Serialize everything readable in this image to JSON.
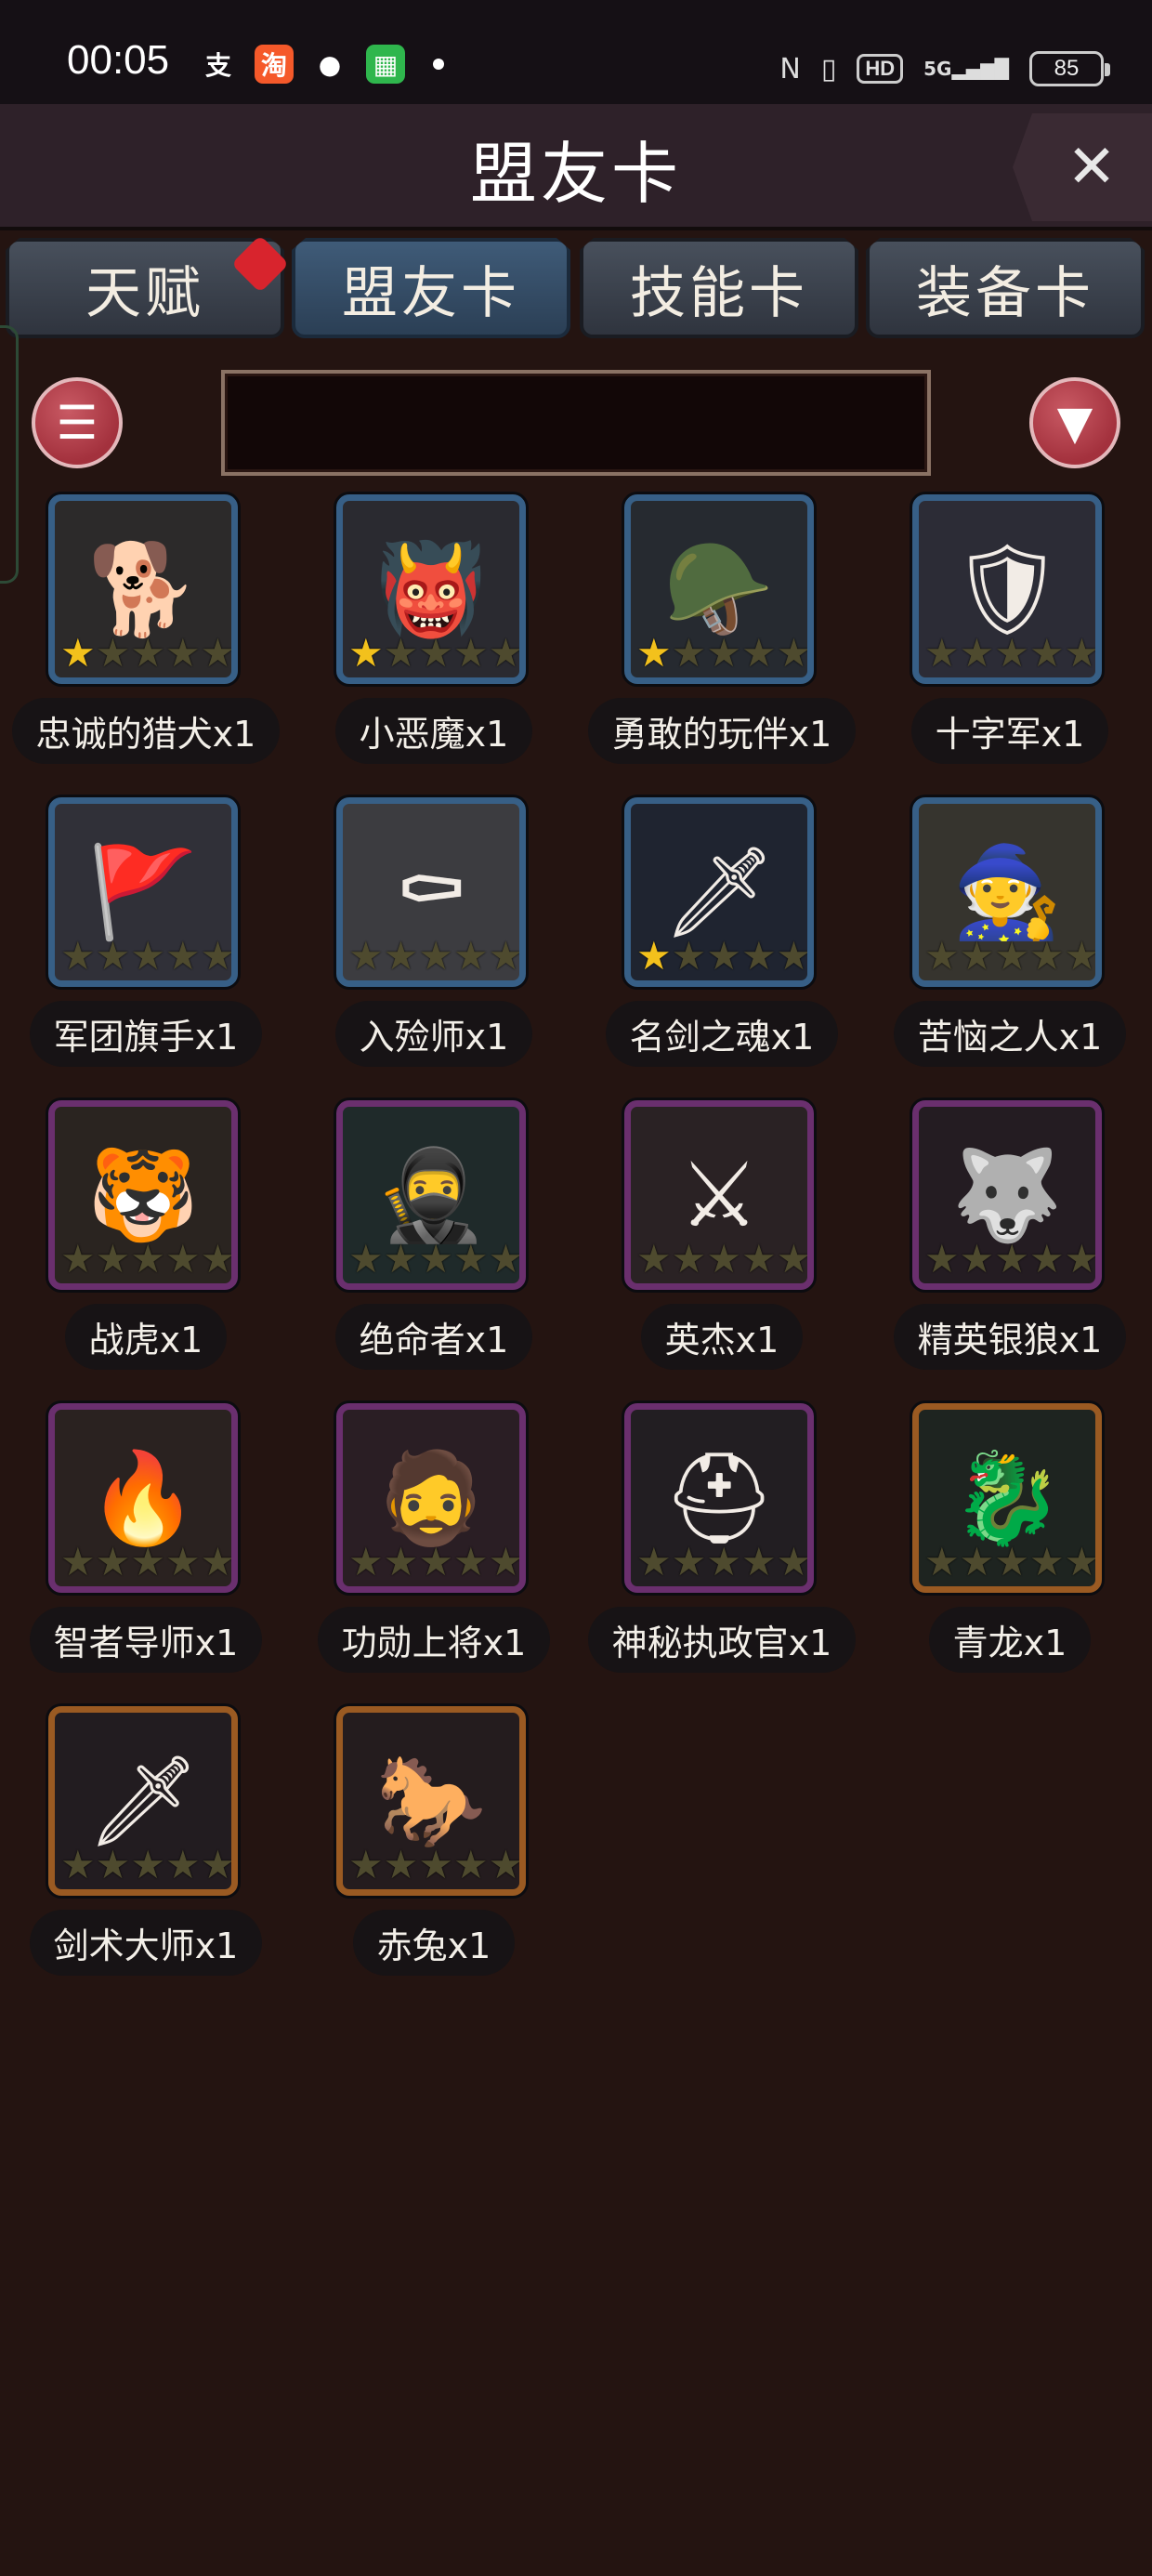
{
  "status_bar": {
    "time": "00:05",
    "notifications": [
      {
        "icon": "alipay-icon",
        "glyph": "支",
        "color": "#ffffff",
        "bg": "transparent"
      },
      {
        "icon": "taobao-icon",
        "glyph": "淘",
        "color": "#ffffff",
        "bg": "#f5592a"
      },
      {
        "icon": "wechat-icon",
        "glyph": "●",
        "color": "#ffffff",
        "bg": "transparent"
      },
      {
        "icon": "green-app-icon",
        "glyph": "▦",
        "color": "#ffffff",
        "bg": "#2fb64d"
      }
    ],
    "nfc_glyph": "N",
    "vibrate_glyph": "▯",
    "hd_label": "HD",
    "signal_label": "5G",
    "battery": "85"
  },
  "header": {
    "title": "盟友卡",
    "close_glyph": "✕"
  },
  "tabs": [
    {
      "label": "天赋",
      "active": false,
      "has_badge": true
    },
    {
      "label": "盟友卡",
      "active": true,
      "has_badge": false
    },
    {
      "label": "技能卡",
      "active": false,
      "has_badge": false
    },
    {
      "label": "装备卡",
      "active": false,
      "has_badge": false
    }
  ],
  "toolbar": {
    "list_glyph": "☰",
    "filter_glyph": "▼",
    "search_value": ""
  },
  "cards": [
    {
      "label": "忠诚的猎犬x1",
      "rarity": "blue",
      "stars": 1,
      "art": "🐕",
      "bg": "#2c2a2a"
    },
    {
      "label": "小恶魔x1",
      "rarity": "blue",
      "stars": 1,
      "art": "👹",
      "bg": "#2a2a30"
    },
    {
      "label": "勇敢的玩伴x1",
      "rarity": "blue",
      "stars": 1,
      "art": "🪖",
      "bg": "#262a30"
    },
    {
      "label": "十字军x1",
      "rarity": "blue",
      "stars": 0,
      "art": "🛡",
      "bg": "#2c2c36"
    },
    {
      "label": "军团旗手x1",
      "rarity": "blue",
      "stars": 0,
      "art": "🚩",
      "bg": "#303038"
    },
    {
      "label": "入殓师x1",
      "rarity": "blue",
      "stars": 0,
      "art": "⚰",
      "bg": "#3c3c40"
    },
    {
      "label": "名剑之魂x1",
      "rarity": "blue",
      "stars": 1,
      "art": "🗡",
      "bg": "#1f2430"
    },
    {
      "label": "苦恼之人x1",
      "rarity": "blue",
      "stars": 0,
      "art": "🧙",
      "bg": "#36342e"
    },
    {
      "label": "战虎x1",
      "rarity": "purple",
      "stars": 0,
      "art": "🐯",
      "bg": "#2a2420"
    },
    {
      "label": "绝命者x1",
      "rarity": "purple",
      "stars": 0,
      "art": "🥷",
      "bg": "#1f2a2a"
    },
    {
      "label": "英杰x1",
      "rarity": "purple",
      "stars": 0,
      "art": "⚔",
      "bg": "#2a2224"
    },
    {
      "label": "精英银狼x1",
      "rarity": "purple",
      "stars": 0,
      "art": "🐺",
      "bg": "#241c22"
    },
    {
      "label": "智者导师x1",
      "rarity": "purple",
      "stars": 0,
      "art": "🔥",
      "bg": "#2a2220"
    },
    {
      "label": "功勋上将x1",
      "rarity": "purple",
      "stars": 0,
      "art": "🧔",
      "bg": "#2a1e24"
    },
    {
      "label": "神秘执政官x1",
      "rarity": "purple",
      "stars": 0,
      "art": "⛑",
      "bg": "#221e22"
    },
    {
      "label": "青龙x1",
      "rarity": "gold",
      "stars": 0,
      "art": "🐉",
      "bg": "#1e2420"
    },
    {
      "label": "剑术大师x1",
      "rarity": "gold",
      "stars": 0,
      "art": "🗡",
      "bg": "#221c20"
    },
    {
      "label": "赤兔x1",
      "rarity": "gold",
      "stars": 0,
      "art": "🐎",
      "bg": "#241c1e"
    }
  ]
}
